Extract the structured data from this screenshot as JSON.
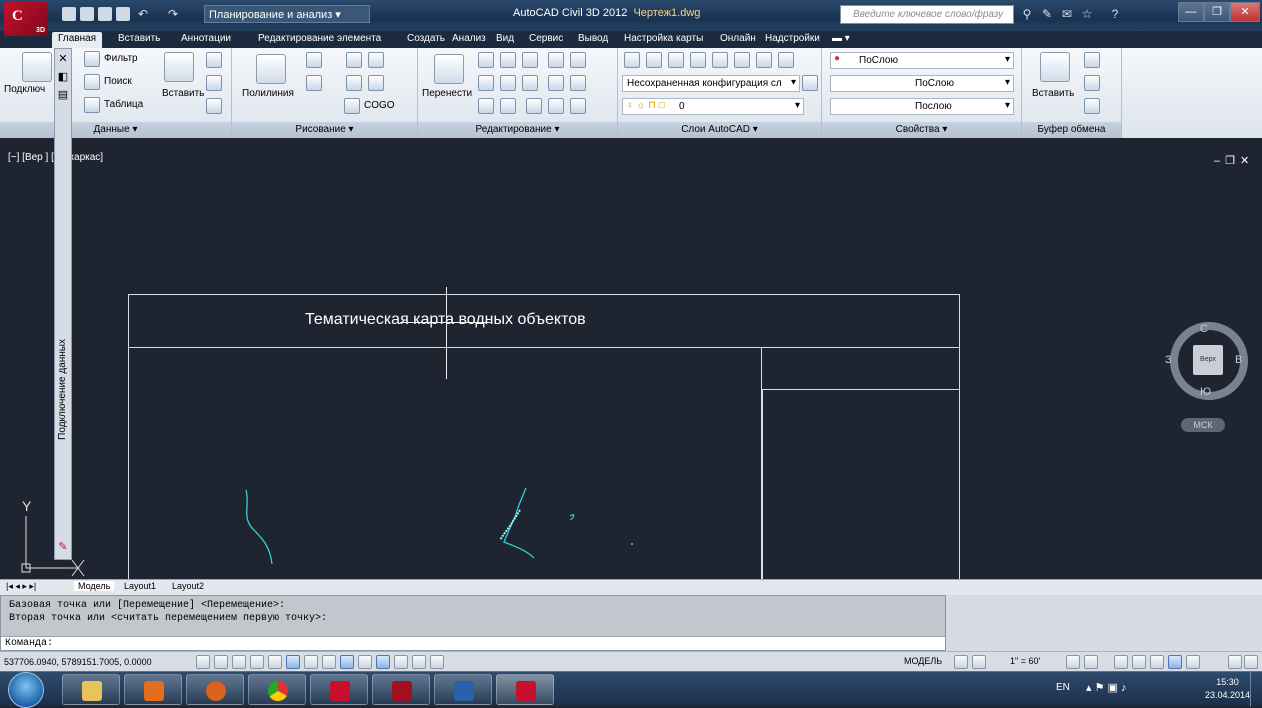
{
  "app": {
    "logo_letter": "C",
    "logo_sub": "3D",
    "workspace": "Планирование и анализ",
    "title_app": "AutoCAD Civil 3D 2012",
    "title_file": "Чертеж1.dwg",
    "search_placeholder": "Введите ключевое слово/фразу"
  },
  "tabs": [
    "Главная",
    "Вставить",
    "Аннотации",
    "Редактирование элемента",
    "Создать",
    "Анализ",
    "Вид",
    "Сервис",
    "Вывод",
    "Настройка карты",
    "Онлайн",
    "Надстройки"
  ],
  "ribbon": {
    "panels": {
      "data": "Данные ▾",
      "draw": "Рисование ▾",
      "edit": "Редактирование ▾",
      "layers": "Слои AutoCAD ▾",
      "props": "Свойства ▾",
      "clip": "Буфер обмена"
    },
    "connect": "Подключ",
    "filter": "Фильтр",
    "search": "Поиск",
    "table": "Таблица",
    "insert": "Вставить",
    "polyline": "Полилиния",
    "cogo": "COGO",
    "move": "Перенести",
    "layer_state": "Несохраненная конфигурация сл",
    "layer_current": "0",
    "color": "ПоСлою",
    "linetype": "ПоСлою",
    "lineweight": "Послою",
    "paste": "Вставить"
  },
  "viewport": {
    "label": "[−] [Вер    ] [2D каркас]",
    "map_title": "Тематическая карта водных объектов",
    "palette_title": "Подключение данных",
    "compass": {
      "n": "С",
      "s": "Ю",
      "w": "З",
      "e": "В",
      "face": "Верх"
    },
    "ucs": "МСК",
    "y_axis": "Y"
  },
  "layout_tabs": [
    "Модель",
    "Layout1",
    "Layout2"
  ],
  "command": {
    "line1": "Базовая точка или [Перемещение] <Перемещение>:",
    "line2": "Вторая точка или <считать перемещением первую точку>:",
    "prompt": "Команда:"
  },
  "status": {
    "coords": "537706.0940, 5789151.7005, 0.0000",
    "model": "МОДЕЛЬ",
    "scale": "1\" = 60'"
  },
  "taskbar": {
    "lang": "EN",
    "time": "15:30",
    "date": "23.04.2014"
  },
  "colors": {
    "water": "#2fd0d8",
    "canvas": "#1f2530",
    "accent": "#c8102e"
  }
}
